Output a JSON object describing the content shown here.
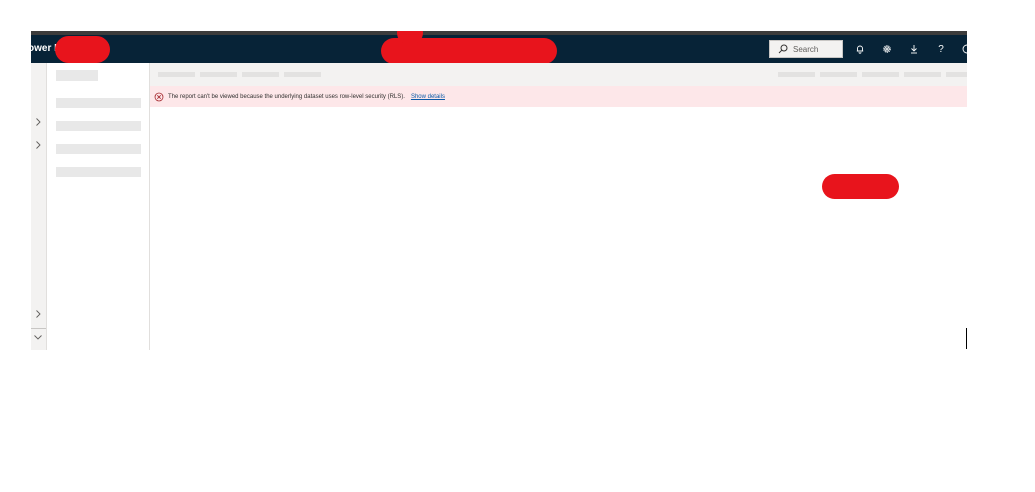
{
  "topbar": {
    "brand": "ower B",
    "search_placeholder": "Search",
    "icons": [
      "bell-icon",
      "gear-icon",
      "download-icon",
      "help-icon",
      "account-icon"
    ],
    "background": "#072337",
    "help_label": "?"
  },
  "notification": {
    "message": "The report can't be viewed because the underlying dataset uses row-level security (RLS).",
    "link": "Show details",
    "background": "#fde7e9",
    "icon": "error-circle-icon"
  },
  "colors": {
    "redaction": "#e8141c",
    "link": "#0b5aa8"
  }
}
